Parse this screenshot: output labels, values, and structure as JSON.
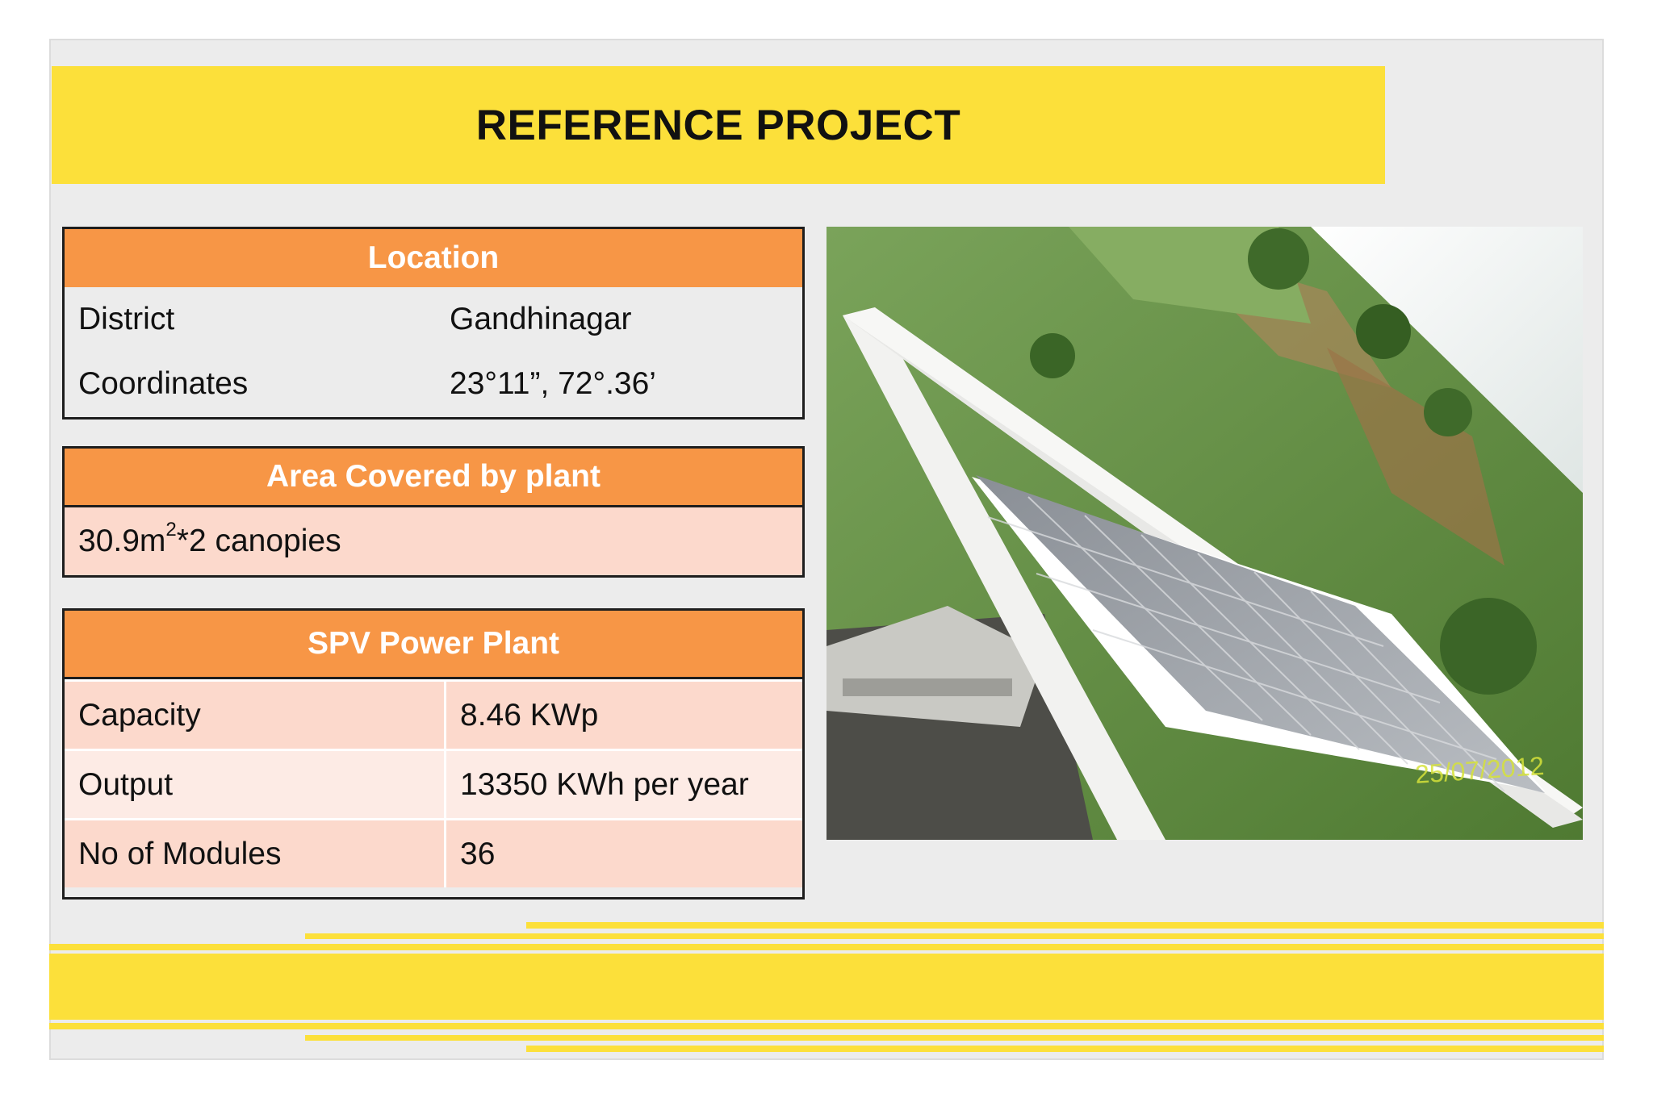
{
  "title": "REFERENCE PROJECT",
  "location": {
    "header": "Location",
    "rows": [
      {
        "label": "District",
        "value": "Gandhinagar"
      },
      {
        "label": "Coordinates",
        "value": "23°11”, 72°.36’"
      }
    ]
  },
  "area": {
    "header": "Area Covered by plant",
    "value_prefix": "30.9m",
    "value_sup": "2",
    "value_suffix": "*2 canopies"
  },
  "spv": {
    "header": "SPV Power Plant",
    "rows": [
      {
        "label": "Capacity",
        "value": "8.46 KWp"
      },
      {
        "label": "Output",
        "value": "13350 KWh per year"
      },
      {
        "label": "No of Modules",
        "value": "36"
      }
    ]
  },
  "photo": {
    "icon": "solar-canopy-photo",
    "date_stamp": "25/07/2012"
  },
  "colors": {
    "title_band": "#fce03a",
    "table_header": "#f79646",
    "row_dark": "#fcd9cc",
    "row_light": "#fdebe5"
  }
}
